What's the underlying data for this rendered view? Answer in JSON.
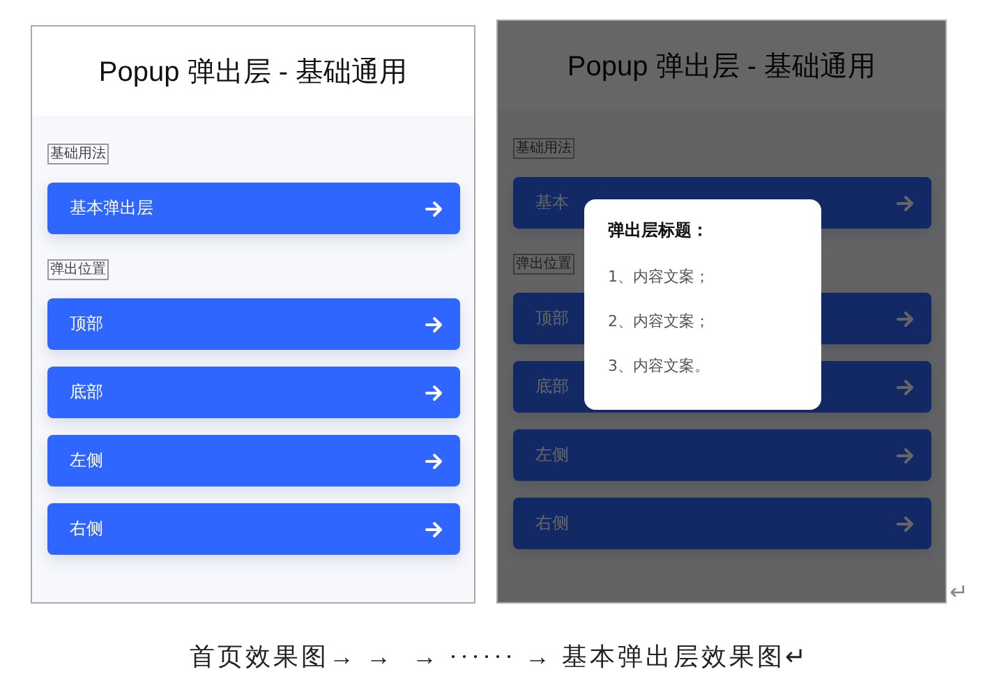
{
  "screens": [
    {
      "title": "Popup 弹出层 - 基础通用",
      "dimmed": false,
      "sections": [
        {
          "label": "基础用法",
          "items": [
            "基本弹出层"
          ]
        },
        {
          "label": "弹出位置",
          "items": [
            "顶部",
            "底部",
            "左侧",
            "右侧"
          ]
        }
      ]
    },
    {
      "title": "Popup 弹出层 - 基础通用",
      "dimmed": true,
      "sections": [
        {
          "label": "基础用法",
          "items": [
            "基本"
          ]
        },
        {
          "label": "弹出位置",
          "items": [
            "顶部",
            "底部",
            "左侧",
            "右侧"
          ]
        }
      ],
      "popup": {
        "title": "弹出层标题：",
        "lines": [
          "1、内容文案；",
          "2、内容文案；",
          "3、内容文案。"
        ]
      }
    }
  ],
  "paragraph_mark": "↵",
  "caption": "首页效果图→ →  → ······ → 基本弹出层效果图↵"
}
